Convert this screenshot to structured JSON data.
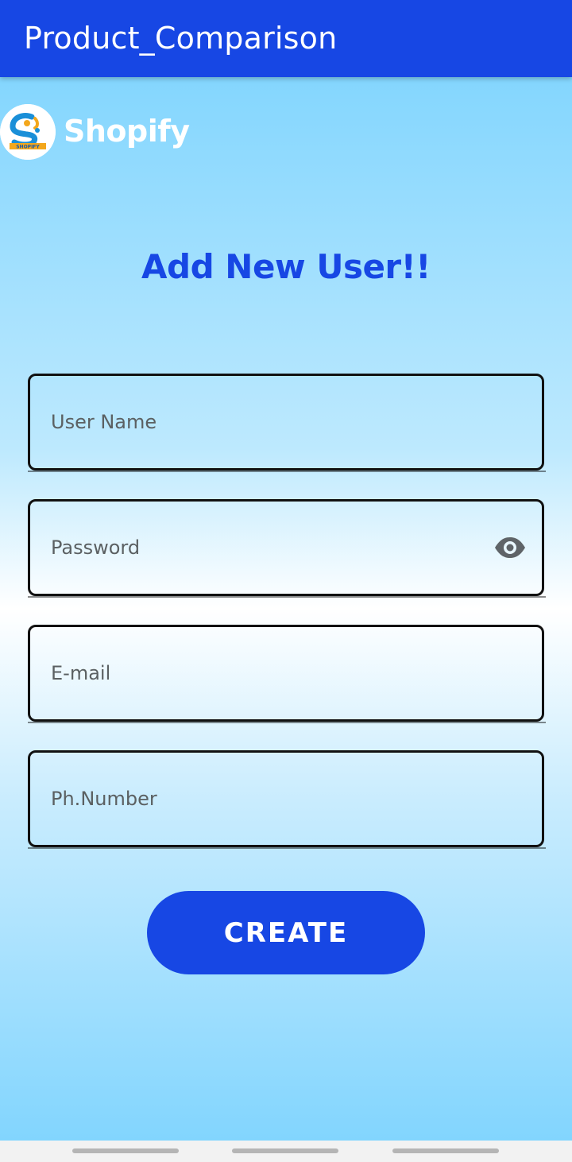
{
  "app_bar": {
    "title": "Product_Comparison"
  },
  "brand": {
    "name": "Shopify",
    "logo_text": "SHOPIFY"
  },
  "heading": "Add New User!!",
  "form": {
    "username": {
      "placeholder": "User Name",
      "value": ""
    },
    "password": {
      "placeholder": "Password",
      "value": "",
      "toggle_icon": "eye-icon"
    },
    "email": {
      "placeholder": "E-mail",
      "value": ""
    },
    "phone": {
      "placeholder": "Ph.Number",
      "value": ""
    },
    "submit_label": "CREATE"
  },
  "colors": {
    "primary": "#1747e4",
    "gradient_top": "#84d6fe",
    "gradient_mid": "#ffffff",
    "field_border": "#111111"
  }
}
